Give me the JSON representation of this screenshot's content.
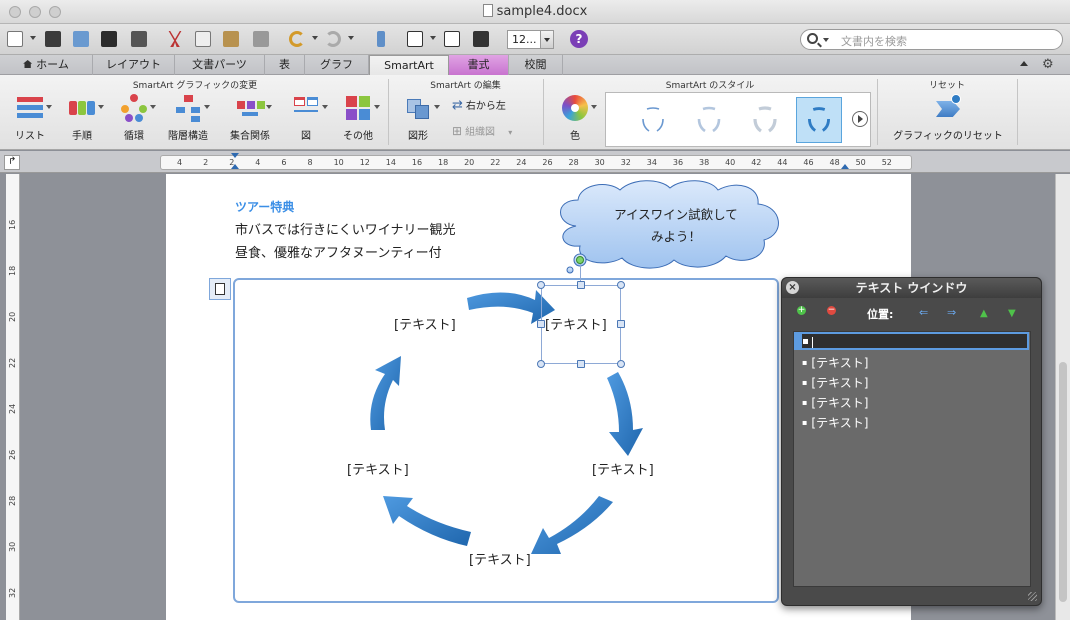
{
  "window": {
    "title": "sample4.docx"
  },
  "toolbar": {
    "zoom_value": "12...",
    "help_label": "?",
    "search_placeholder": "文書内を検索"
  },
  "tabs": [
    {
      "label": "ホーム"
    },
    {
      "label": "レイアウト"
    },
    {
      "label": "文書パーツ"
    },
    {
      "label": "表"
    },
    {
      "label": "グラフ"
    },
    {
      "label": "SmartArt"
    },
    {
      "label": "書式"
    },
    {
      "label": "校閲"
    }
  ],
  "ribbon": {
    "group_change": "SmartArt グラフィックの変更",
    "group_edit": "SmartArt の編集",
    "group_style": "SmartArt のスタイル",
    "group_reset": "リセット",
    "layouts": [
      "リスト",
      "手順",
      "循環",
      "階層構造",
      "集合関係",
      "図",
      "その他"
    ],
    "shape_label": "図形",
    "rtl_label": "右から左",
    "org_label": "組織図",
    "color_label": "色",
    "reset_label": "グラフィックのリセット"
  },
  "ruler": {
    "h_ticks": [
      "4",
      "2",
      "2",
      "4",
      "6",
      "8",
      "10",
      "12",
      "14",
      "16",
      "18",
      "20",
      "22",
      "24",
      "26",
      "28",
      "30",
      "32",
      "34",
      "36",
      "38",
      "40",
      "42",
      "44",
      "46",
      "48",
      "50",
      "52"
    ],
    "v_ticks": [
      "16",
      "18",
      "20",
      "22",
      "24",
      "26",
      "28",
      "30",
      "32"
    ]
  },
  "document": {
    "heading": "ツアー特典",
    "line1": "市バスでは行きにくいワイナリー観光",
    "line2": "昼食、優雅なアフタヌーンティー付",
    "callout_line1": "アイスワイン試飲して",
    "callout_line2": "みよう！",
    "smartart_labels": [
      "[テキスト]",
      "[テキスト]",
      "[テキスト]",
      "[テキスト]",
      "[テキスト]"
    ]
  },
  "text_window": {
    "title": "テキスト ウインドウ",
    "close": "×",
    "position_label": "位置:",
    "items": [
      "[テキスト]",
      "[テキスト]",
      "[テキスト]",
      "[テキスト]"
    ]
  },
  "colors": {
    "accent_blue": "#3a8ee6",
    "arrow_blue": "#2f7cc4",
    "format_tab": "#c873cf"
  }
}
